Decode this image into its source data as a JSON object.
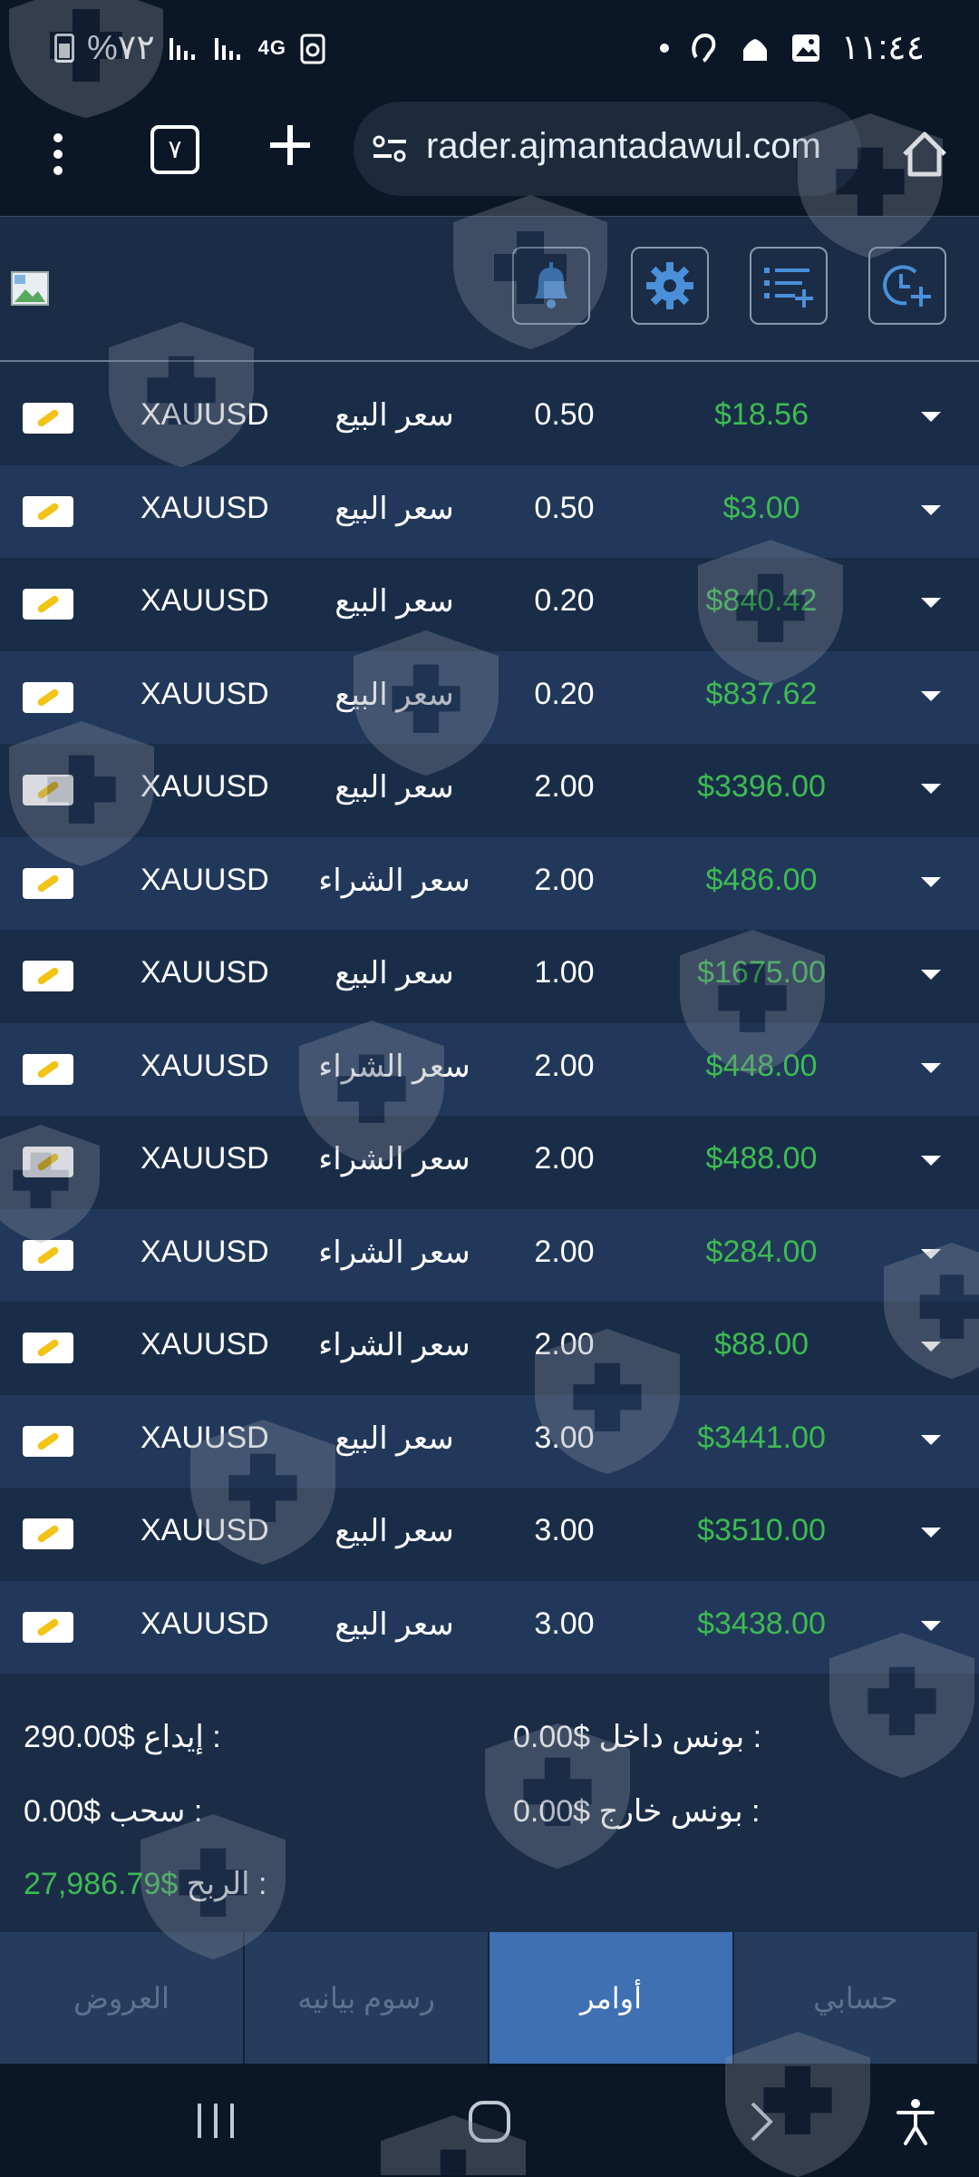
{
  "status_bar": {
    "battery": "%٧٢",
    "network": "4G",
    "time": "١١:٤٤"
  },
  "browser": {
    "url": "rader.ajmantadawul.com",
    "tab_count": "٧"
  },
  "orders": [
    {
      "symbol": "XAUUSD",
      "side": "سعر البيع",
      "lot": "0.50",
      "amount": "$18.56"
    },
    {
      "symbol": "XAUUSD",
      "side": "سعر البيع",
      "lot": "0.50",
      "amount": "$3.00"
    },
    {
      "symbol": "XAUUSD",
      "side": "سعر البيع",
      "lot": "0.20",
      "amount": "$840.42"
    },
    {
      "symbol": "XAUUSD",
      "side": "سعر البيع",
      "lot": "0.20",
      "amount": "$837.62"
    },
    {
      "symbol": "XAUUSD",
      "side": "سعر البيع",
      "lot": "2.00",
      "amount": "$3396.00"
    },
    {
      "symbol": "XAUUSD",
      "side": "سعر الشراء",
      "lot": "2.00",
      "amount": "$486.00"
    },
    {
      "symbol": "XAUUSD",
      "side": "سعر البيع",
      "lot": "1.00",
      "amount": "$1675.00"
    },
    {
      "symbol": "XAUUSD",
      "side": "سعر الشراء",
      "lot": "2.00",
      "amount": "$448.00"
    },
    {
      "symbol": "XAUUSD",
      "side": "سعر الشراء",
      "lot": "2.00",
      "amount": "$488.00"
    },
    {
      "symbol": "XAUUSD",
      "side": "سعر الشراء",
      "lot": "2.00",
      "amount": "$284.00"
    },
    {
      "symbol": "XAUUSD",
      "side": "سعر الشراء",
      "lot": "2.00",
      "amount": "$88.00"
    },
    {
      "symbol": "XAUUSD",
      "side": "سعر البيع",
      "lot": "3.00",
      "amount": "$3441.00"
    },
    {
      "symbol": "XAUUSD",
      "side": "سعر البيع",
      "lot": "3.00",
      "amount": "$3510.00"
    },
    {
      "symbol": "XAUUSD",
      "side": "سعر البيع",
      "lot": "3.00",
      "amount": "$3438.00"
    }
  ],
  "summary": {
    "deposit_label": "إيداع :",
    "deposit_value": "290.00$",
    "withdraw_label": "سحب :",
    "withdraw_value": "0.00$",
    "profit_label": "الربح :",
    "profit_value": "27,986.79$",
    "bonus_in_label": "بونس داخل :",
    "bonus_in_value": "0.00$",
    "bonus_out_label": "بونس خارج :",
    "bonus_out_value": "0.00$"
  },
  "tabs": [
    {
      "label": "العروض",
      "active": false
    },
    {
      "label": "رسوم بيانيه",
      "active": false
    },
    {
      "label": "أوامر",
      "active": true
    },
    {
      "label": "حسابي",
      "active": false
    }
  ],
  "colors": {
    "profit_green": "#3dbb52",
    "active_tab": "#3f70b4",
    "background": "#1b2c47"
  },
  "icons": [
    "bell-icon",
    "gear-icon",
    "list-add-icon",
    "clock-add-icon",
    "broken-image-icon",
    "gold-bar-icon",
    "chevron-down-icon",
    "shield-watermark-icon"
  ]
}
